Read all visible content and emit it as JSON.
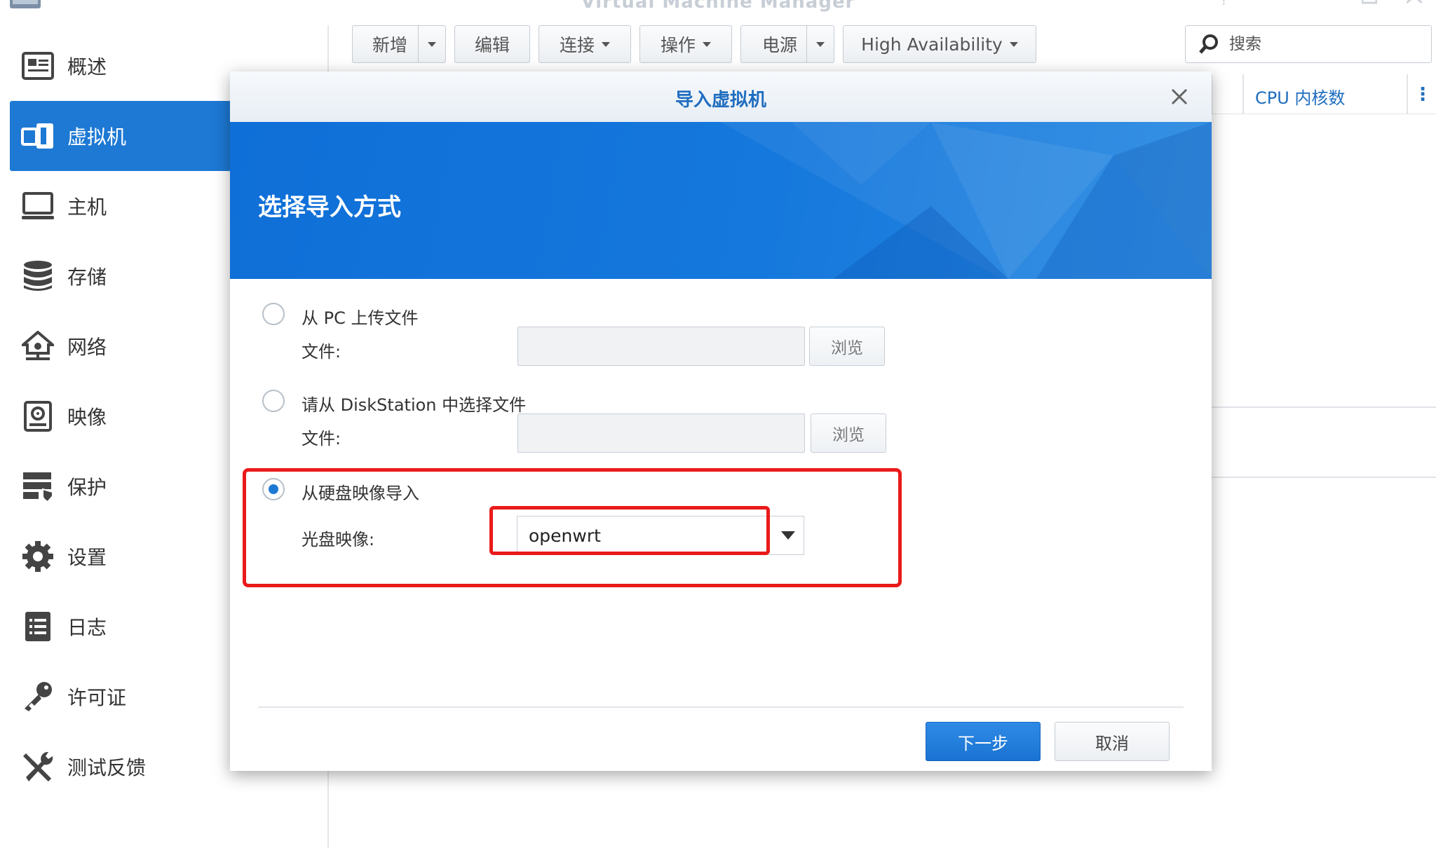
{
  "app": {
    "title": "Virtual Machine Manager"
  },
  "sidebar": {
    "items": [
      {
        "label": "概述",
        "icon": "overview-icon"
      },
      {
        "label": "虚拟机",
        "icon": "virtual-machine-icon",
        "active": true
      },
      {
        "label": "主机",
        "icon": "host-icon"
      },
      {
        "label": "存储",
        "icon": "storage-icon"
      },
      {
        "label": "网络",
        "icon": "network-icon"
      },
      {
        "label": "映像",
        "icon": "image-icon"
      },
      {
        "label": "保护",
        "icon": "protection-icon"
      },
      {
        "label": "设置",
        "icon": "gear-icon"
      },
      {
        "label": "日志",
        "icon": "log-icon"
      },
      {
        "label": "许可证",
        "icon": "key-icon"
      },
      {
        "label": "测试反馈",
        "icon": "tools-icon"
      }
    ]
  },
  "toolbar": {
    "create_label": "新增",
    "edit_label": "编辑",
    "connect_label": "连接",
    "action_label": "操作",
    "power_label": "电源",
    "ha_label": "High Availability"
  },
  "search": {
    "placeholder": "搜索"
  },
  "list": {
    "column_cpu": "CPU 内核数"
  },
  "dialog": {
    "title": "导入虚拟机",
    "banner_title": "选择导入方式",
    "option_pc": "从 PC 上传文件",
    "option_diskstation": "请从 DiskStation 中选择文件",
    "option_disk_image": "从硬盘映像导入",
    "file_label_1": "文件:",
    "file_label_2": "文件:",
    "browse_label_1": "浏览",
    "browse_label_2": "浏览",
    "iso_label": "光盘映像:",
    "iso_value": "openwrt",
    "selected_option": "从硬盘映像导入",
    "next_label": "下一步",
    "cancel_label": "取消"
  },
  "colors": {
    "accent": "#1d79d4",
    "highlight": "#ea1a1a"
  }
}
